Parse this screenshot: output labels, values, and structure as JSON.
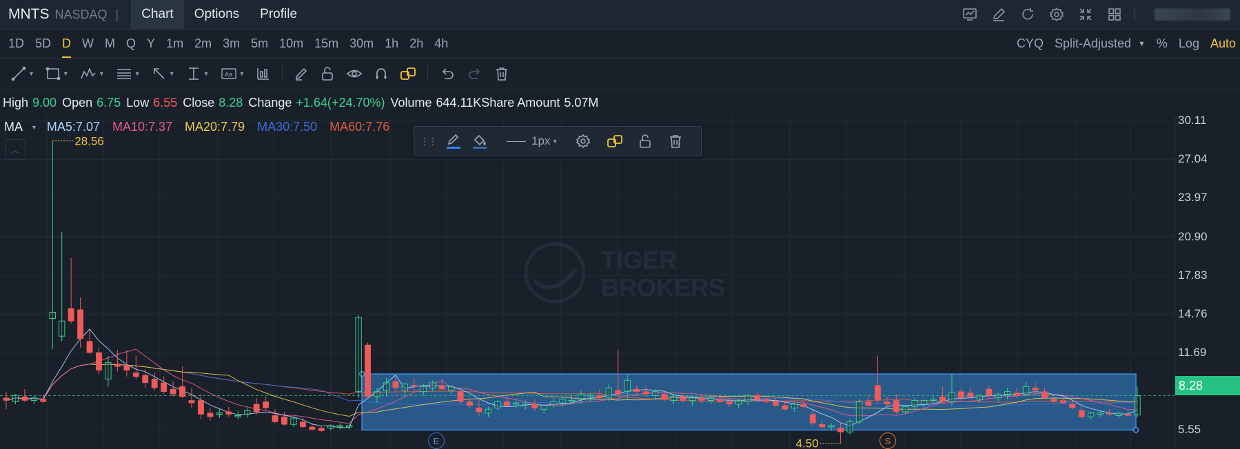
{
  "header": {
    "symbol": "MNTS",
    "exchange": "NASDAQ",
    "tabs": [
      {
        "label": "Chart",
        "active": true
      },
      {
        "label": "Options"
      },
      {
        "label": "Profile"
      }
    ],
    "icons": [
      "chart-icon",
      "edit-icon",
      "refresh-icon",
      "gear-icon",
      "compress-icon",
      "grid-icon"
    ]
  },
  "timeframes": [
    "1D",
    "5D",
    "D",
    "W",
    "M",
    "Q",
    "Y",
    "1m",
    "2m",
    "3m",
    "5m",
    "10m",
    "15m",
    "30m",
    "1h",
    "2h",
    "4h"
  ],
  "active_timeframe": "D",
  "options": {
    "cyq": "CYQ",
    "adjust": "Split-Adjusted",
    "percent": "%",
    "log": "Log",
    "auto": "Auto"
  },
  "quote": {
    "high_label": "High",
    "high": "9.00",
    "open_label": "Open",
    "open": "6.75",
    "low_label": "Low",
    "low": "6.55",
    "close_label": "Close",
    "close": "8.28",
    "change_label": "Change",
    "change": "+1.64(+24.70%)",
    "volume_label": "Volume",
    "volume": "644.11K",
    "amount_label": "Share Amount",
    "amount": "5.07M"
  },
  "indicator": {
    "name": "MA",
    "ma5": "MA5:7.07",
    "ma10": "MA10:7.37",
    "ma20": "MA20:7.79",
    "ma30": "MA30:7.50",
    "ma60": "MA60:7.76"
  },
  "colors": {
    "ma5": "#a8d3ff",
    "ma10": "#e75b8d",
    "ma20": "#e9c84c",
    "ma30": "#3a6cd8",
    "ma60": "#e05a3d",
    "up": "#3bd08f",
    "down": "#ef5b5b",
    "accent": "#f4c43a",
    "current": "#26c281"
  },
  "drawing_toolbar": {
    "stroke": "1px"
  },
  "annotations": {
    "max_label": "28.56",
    "min_label": "4.50",
    "event_e": "E",
    "event_s": "S"
  },
  "watermark": {
    "line1": "TIGER",
    "line2": "BROKERS"
  },
  "price_axis": {
    "ticks": [
      "30.11",
      "27.04",
      "23.97",
      "20.90",
      "17.83",
      "14.76",
      "11.69",
      "8.28",
      "5.55"
    ],
    "current": "8.28"
  },
  "chart_data": {
    "type": "candlestick",
    "y_range": [
      4.1,
      30.5
    ],
    "rectangle": {
      "top": 10.0,
      "bottom": 5.55
    },
    "current_price": 8.28,
    "candles": [
      [
        8.1,
        8.6,
        7.2,
        7.9
      ],
      [
        7.8,
        8.4,
        7.6,
        8.3
      ],
      [
        8.2,
        8.8,
        7.8,
        7.9
      ],
      [
        7.9,
        8.3,
        7.6,
        8.1
      ],
      [
        8.0,
        8.4,
        7.7,
        7.8
      ],
      [
        14.4,
        28.5,
        12.0,
        14.9
      ],
      [
        13.0,
        21.3,
        12.6,
        14.2
      ],
      [
        15.2,
        19.2,
        14.0,
        14.2
      ],
      [
        15.1,
        16.1,
        12.1,
        12.8
      ],
      [
        12.6,
        13.5,
        11.6,
        11.7
      ],
      [
        11.7,
        12.1,
        10.0,
        10.3
      ],
      [
        9.6,
        11.4,
        9.0,
        10.9
      ],
      [
        10.8,
        11.9,
        10.2,
        10.6
      ],
      [
        10.7,
        11.9,
        9.8,
        10.3
      ],
      [
        10.1,
        11.5,
        9.6,
        9.8
      ],
      [
        9.9,
        10.4,
        8.9,
        9.3
      ],
      [
        9.6,
        10.1,
        8.7,
        8.9
      ],
      [
        9.3,
        9.8,
        8.4,
        8.6
      ],
      [
        8.8,
        9.4,
        8.2,
        8.4
      ],
      [
        9.0,
        10.6,
        8.1,
        8.2
      ],
      [
        7.9,
        8.9,
        7.3,
        7.7
      ],
      [
        7.9,
        8.4,
        6.4,
        6.8
      ],
      [
        6.9,
        7.3,
        6.3,
        6.6
      ],
      [
        6.8,
        7.2,
        6.5,
        6.9
      ],
      [
        7.0,
        7.4,
        6.6,
        6.8
      ],
      [
        6.6,
        7.1,
        6.4,
        6.7
      ],
      [
        6.8,
        7.3,
        6.5,
        7.1
      ],
      [
        7.6,
        8.1,
        6.8,
        7.0
      ],
      [
        7.8,
        8.2,
        7.1,
        7.3
      ],
      [
        6.7,
        7.2,
        6.1,
        6.2
      ],
      [
        6.6,
        7.0,
        5.9,
        6.0
      ],
      [
        6.0,
        6.6,
        5.8,
        6.5
      ],
      [
        6.2,
        6.5,
        5.7,
        5.8
      ],
      [
        5.8,
        6.1,
        5.5,
        5.6
      ],
      [
        5.7,
        5.9,
        5.4,
        5.5
      ],
      [
        5.7,
        6.0,
        5.5,
        5.9
      ],
      [
        5.8,
        6.1,
        5.6,
        5.9
      ],
      [
        5.8,
        6.0,
        5.6,
        5.9
      ],
      [
        8.6,
        14.7,
        8.1,
        14.5
      ],
      [
        12.3,
        12.5,
        8.0,
        8.2
      ],
      [
        8.2,
        8.9,
        7.7,
        8.6
      ],
      [
        8.7,
        9.7,
        8.2,
        9.3
      ],
      [
        9.4,
        9.8,
        8.6,
        8.9
      ],
      [
        8.7,
        9.3,
        8.1,
        9.2
      ],
      [
        9.1,
        9.7,
        8.5,
        9.0
      ],
      [
        8.6,
        9.2,
        8.3,
        9.0
      ],
      [
        8.9,
        9.5,
        8.6,
        9.3
      ],
      [
        9.1,
        9.6,
        8.7,
        8.8
      ],
      [
        8.7,
        9.1,
        8.4,
        9.0
      ],
      [
        8.6,
        8.9,
        7.6,
        7.8
      ],
      [
        7.8,
        8.1,
        7.3,
        7.5
      ],
      [
        7.3,
        7.9,
        6.7,
        7.0
      ],
      [
        6.9,
        7.4,
        6.6,
        7.2
      ],
      [
        7.3,
        7.9,
        7.1,
        7.8
      ],
      [
        7.8,
        8.2,
        7.4,
        7.5
      ],
      [
        7.6,
        7.9,
        7.3,
        7.7
      ],
      [
        7.5,
        7.9,
        7.2,
        7.6
      ],
      [
        7.6,
        8.0,
        7.1,
        7.3
      ],
      [
        7.2,
        7.6,
        6.9,
        7.5
      ],
      [
        7.6,
        8.1,
        7.3,
        7.8
      ],
      [
        7.7,
        8.2,
        7.4,
        8.0
      ],
      [
        7.9,
        8.3,
        7.6,
        7.9
      ],
      [
        8.0,
        8.7,
        7.7,
        8.4
      ],
      [
        8.2,
        8.5,
        7.8,
        8.3
      ],
      [
        8.3,
        8.8,
        7.9,
        8.1
      ],
      [
        8.1,
        9.2,
        7.8,
        8.9
      ],
      [
        8.7,
        11.9,
        8.2,
        8.4
      ],
      [
        8.6,
        9.9,
        8.0,
        9.5
      ],
      [
        8.8,
        9.1,
        8.3,
        8.6
      ],
      [
        8.6,
        9.0,
        8.2,
        8.4
      ],
      [
        8.3,
        8.8,
        7.9,
        8.6
      ],
      [
        8.4,
        8.7,
        7.8,
        8.0
      ],
      [
        7.9,
        8.4,
        7.6,
        8.2
      ],
      [
        8.2,
        8.5,
        7.7,
        7.9
      ],
      [
        7.9,
        8.3,
        7.5,
        8.1
      ],
      [
        8.1,
        8.4,
        7.7,
        7.9
      ],
      [
        7.9,
        8.3,
        7.6,
        8.1
      ],
      [
        8.0,
        8.4,
        7.7,
        7.8
      ],
      [
        7.8,
        8.1,
        7.4,
        7.6
      ],
      [
        7.6,
        8.0,
        7.3,
        7.9
      ],
      [
        7.8,
        8.4,
        7.5,
        8.3
      ],
      [
        8.3,
        8.6,
        7.8,
        8.0
      ],
      [
        8.0,
        8.3,
        7.6,
        7.8
      ],
      [
        7.8,
        8.1,
        7.4,
        7.5
      ],
      [
        7.5,
        7.9,
        7.1,
        7.2
      ],
      [
        7.3,
        7.8,
        7.0,
        7.6
      ],
      [
        7.6,
        7.9,
        7.3,
        7.4
      ],
      [
        6.8,
        7.1,
        5.9,
        6.1
      ],
      [
        6.0,
        6.3,
        5.6,
        5.8
      ],
      [
        5.8,
        6.1,
        5.5,
        5.9
      ],
      [
        5.7,
        6.2,
        4.5,
        5.4
      ],
      [
        5.4,
        6.4,
        5.2,
        6.2
      ],
      [
        6.2,
        8.0,
        6.0,
        7.8
      ],
      [
        7.8,
        8.3,
        7.4,
        7.5
      ],
      [
        9.1,
        11.5,
        7.6,
        7.9
      ],
      [
        7.8,
        8.2,
        7.4,
        7.6
      ],
      [
        7.9,
        8.4,
        6.8,
        7.0
      ],
      [
        7.0,
        7.5,
        6.8,
        7.4
      ],
      [
        7.4,
        8.1,
        7.1,
        7.9
      ],
      [
        7.6,
        8.0,
        7.3,
        7.9
      ],
      [
        7.9,
        8.3,
        7.6,
        8.0
      ],
      [
        8.2,
        9.0,
        7.6,
        7.8
      ],
      [
        7.8,
        10.0,
        7.5,
        8.5
      ],
      [
        8.6,
        8.9,
        7.8,
        8.1
      ],
      [
        8.5,
        8.9,
        8.0,
        8.2
      ],
      [
        8.0,
        8.4,
        7.7,
        8.3
      ],
      [
        8.8,
        9.1,
        8.0,
        8.3
      ],
      [
        8.1,
        8.5,
        7.8,
        8.4
      ],
      [
        8.4,
        8.9,
        8.0,
        8.6
      ],
      [
        8.5,
        8.9,
        8.1,
        8.3
      ],
      [
        8.4,
        9.4,
        8.2,
        9.0
      ],
      [
        8.9,
        9.3,
        8.3,
        8.7
      ],
      [
        8.6,
        8.9,
        8.0,
        8.1
      ],
      [
        8.0,
        8.3,
        7.6,
        7.8
      ],
      [
        7.9,
        8.3,
        7.6,
        7.7
      ],
      [
        7.6,
        7.9,
        7.2,
        7.3
      ],
      [
        7.1,
        7.4,
        6.4,
        6.6
      ],
      [
        6.6,
        7.0,
        6.4,
        6.9
      ],
      [
        6.8,
        7.1,
        6.6,
        6.9
      ],
      [
        6.9,
        7.2,
        6.7,
        6.8
      ],
      [
        6.7,
        7.0,
        6.5,
        6.9
      ],
      [
        6.8,
        7.1,
        6.6,
        6.7
      ],
      [
        6.75,
        9.0,
        6.55,
        8.28
      ]
    ]
  }
}
